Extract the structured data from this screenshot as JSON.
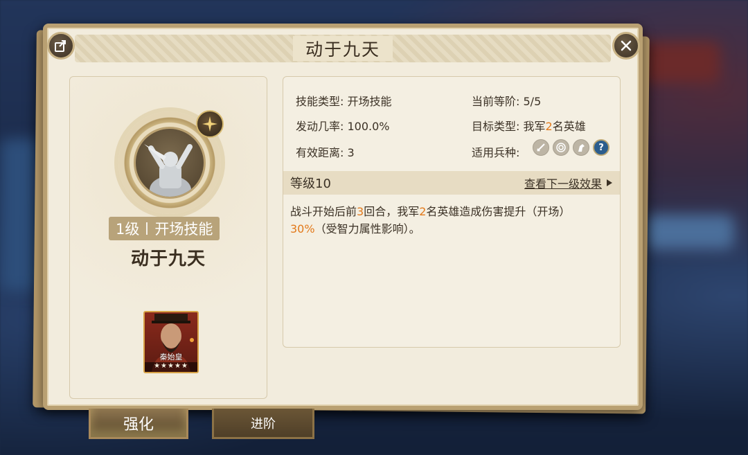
{
  "dialog": {
    "title": "动于九天"
  },
  "skill": {
    "level_label": "1级",
    "category_label": "开场技能",
    "name": "动于九天"
  },
  "hero": {
    "name": "秦始皇",
    "stars": "★★★★★",
    "star_count": 5
  },
  "info": {
    "skill_type_key": "技能类型:",
    "skill_type_value": "开场技能",
    "current_rank_key": "当前等阶:",
    "current_rank_value": "5/5",
    "trigger_rate_key": "发动几率:",
    "trigger_rate_value": "100.0%",
    "target_type_key": "目标类型:",
    "target_type_prefix": "我军",
    "target_type_count": "2",
    "target_type_suffix": "名英雄",
    "range_key": "有效距离:",
    "range_value": "3",
    "troop_type_key": "适用兵种:",
    "troop_icons": [
      "sword-icon",
      "target-icon",
      "horse-icon",
      "question-icon"
    ],
    "troop_question_glyph": "?"
  },
  "level_section": {
    "level_label": "等级10",
    "next_level_link": "查看下一级效果"
  },
  "description": {
    "part1": "战斗开始后前",
    "rounds": "3",
    "part2": "回合，我军",
    "heroes": "2",
    "part3": "名英雄造成伤害提升（开场）",
    "percent": "30%",
    "part4": "（受智力属性影响）。"
  },
  "tabs": {
    "strengthen": "强化",
    "advance": "进阶"
  },
  "colors": {
    "highlight": "#e2791a",
    "panel_bg": "#f2ecdd",
    "frame": "#b9a072"
  }
}
